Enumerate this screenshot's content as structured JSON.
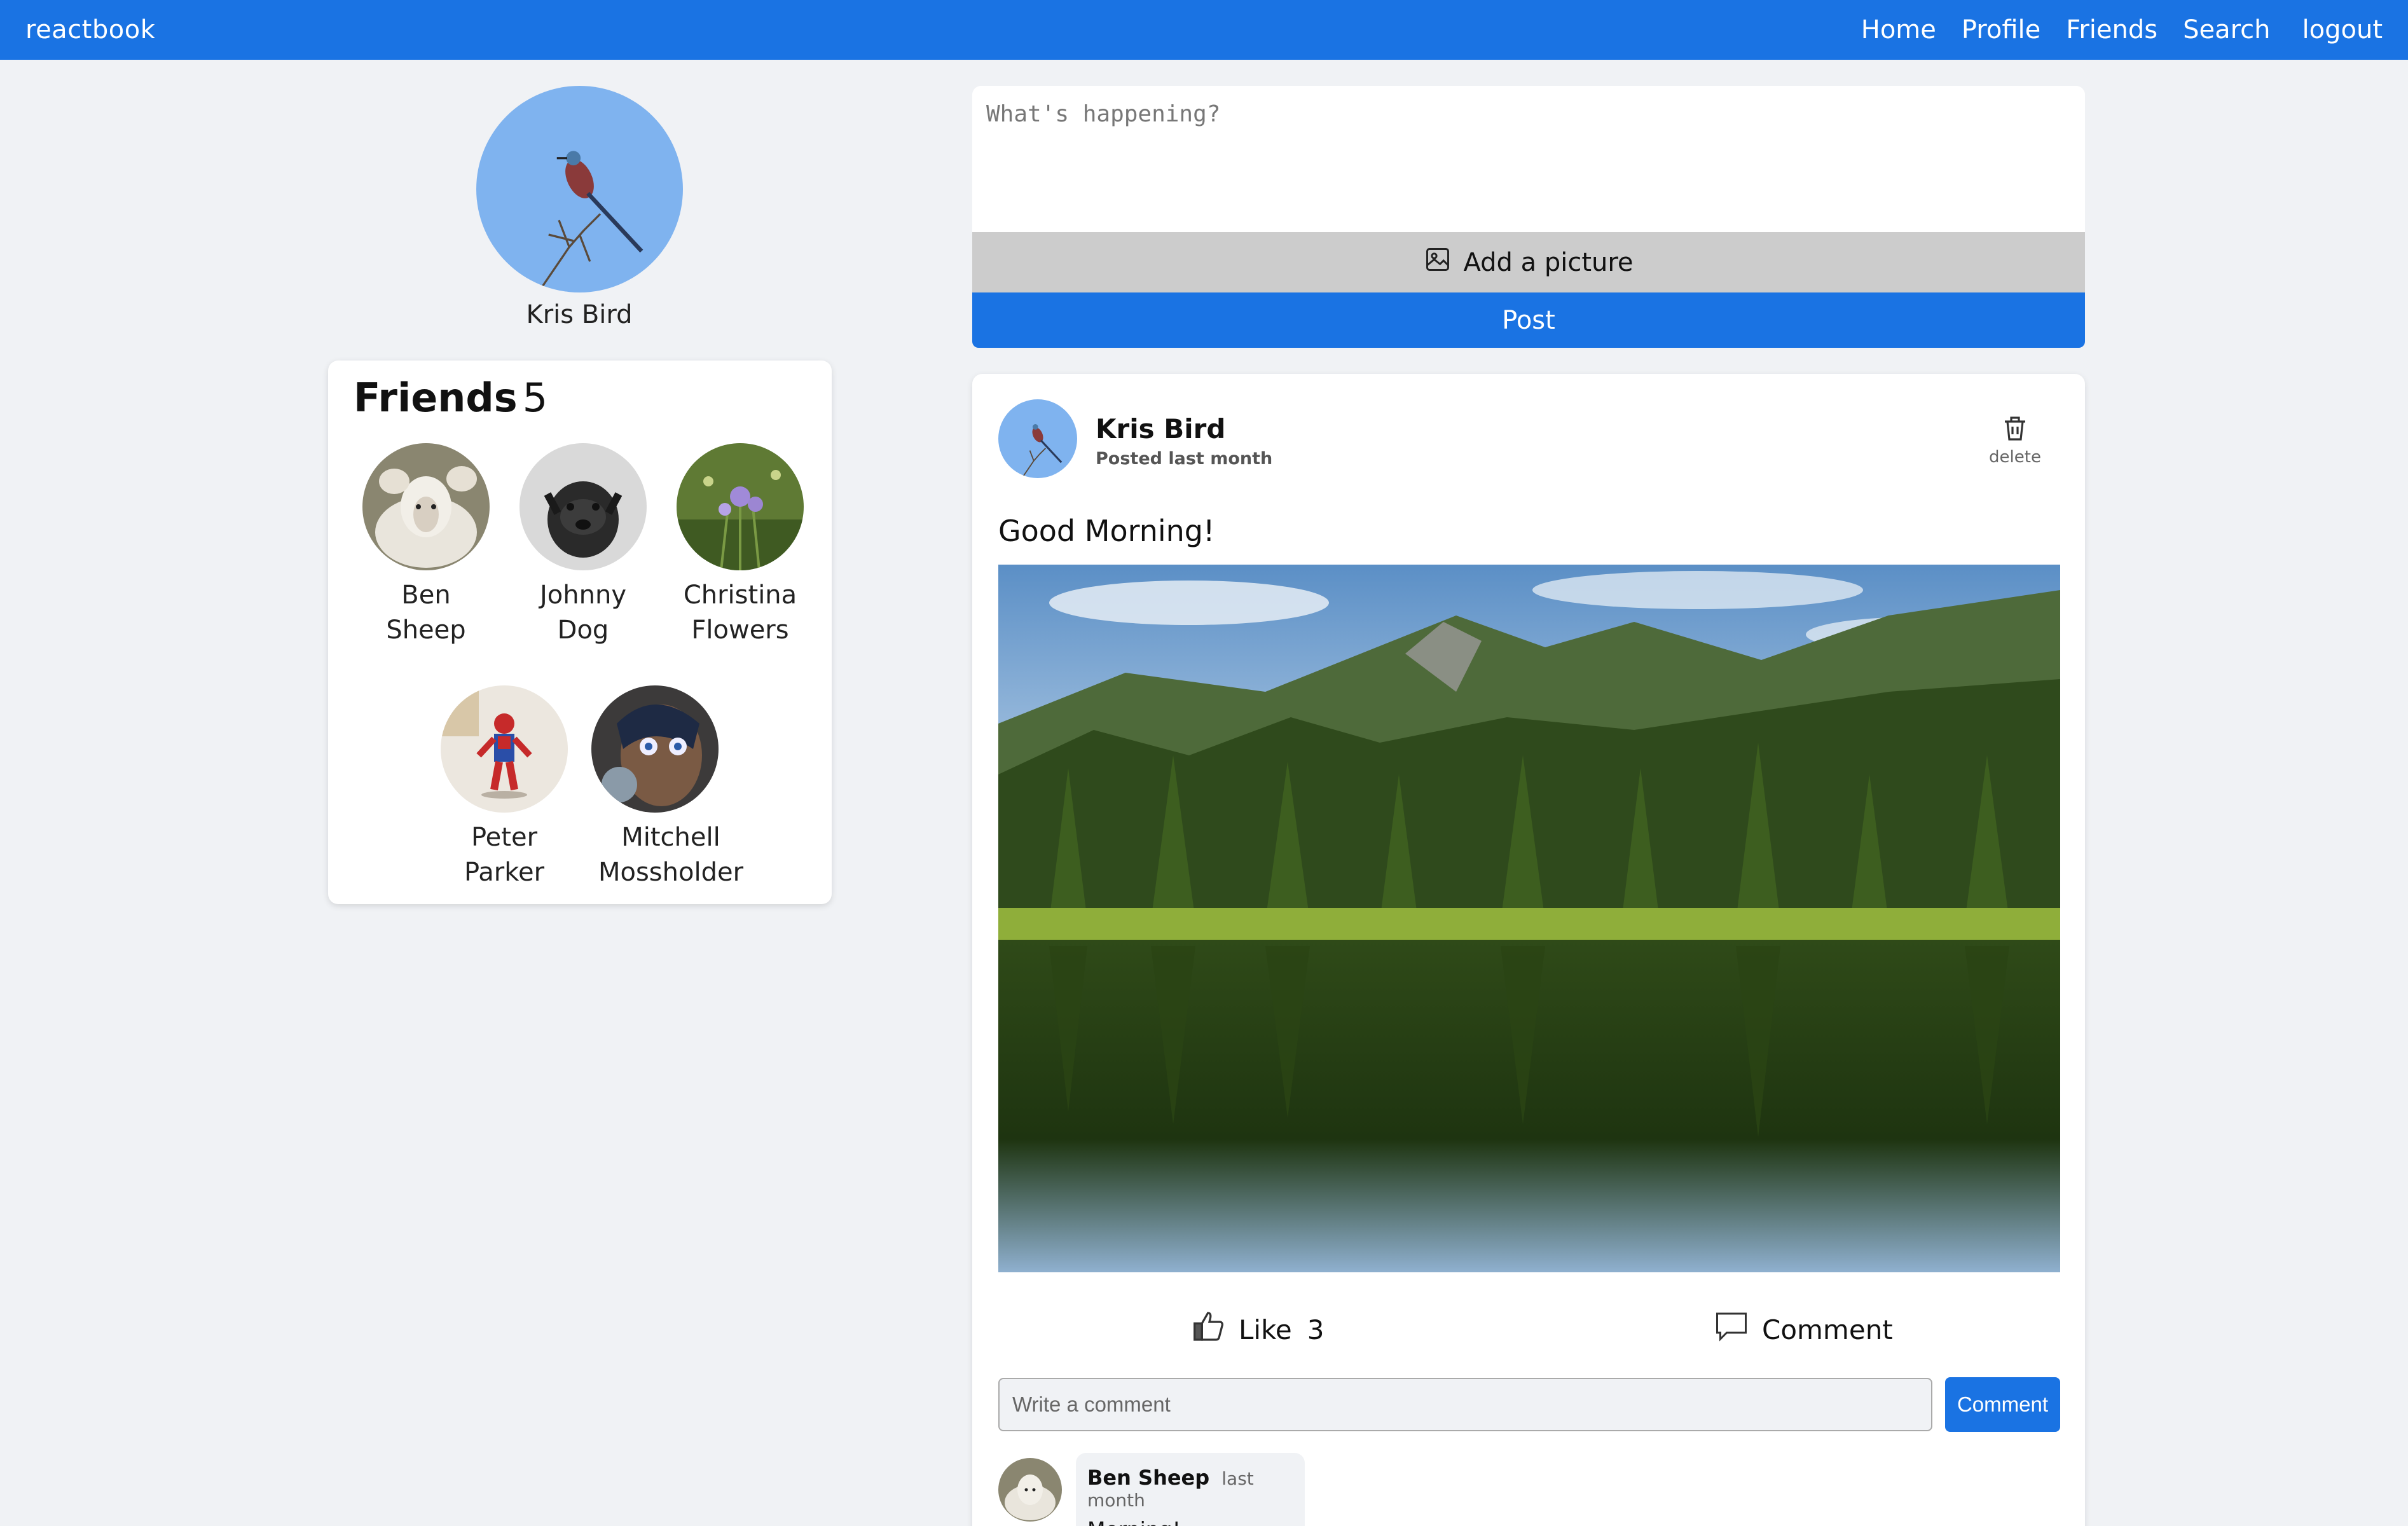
{
  "nav": {
    "brand": "reactbook",
    "links": [
      "Home",
      "Profile",
      "Friends",
      "Search"
    ],
    "logout": "logout"
  },
  "profile": {
    "name": "Kris Bird"
  },
  "friends": {
    "title": "Friends",
    "count": "5",
    "list": [
      {
        "first": "Ben",
        "last": "Sheep"
      },
      {
        "first": "Johnny",
        "last": "Dog"
      },
      {
        "first": "Christina",
        "last": "Flowers"
      },
      {
        "first": "Peter",
        "last": "Parker"
      },
      {
        "first": "Mitchell",
        "last": "Mossholder"
      }
    ]
  },
  "composer": {
    "placeholder": "What's happening?",
    "add_picture": "Add a picture",
    "post": "Post"
  },
  "post": {
    "author": "Kris Bird",
    "time": "Posted last month",
    "delete": "delete",
    "text": "Good Morning!",
    "like_label": "Like",
    "like_count": "3",
    "comment_label": "Comment",
    "comment_placeholder": "Write a comment",
    "comment_submit": "Comment",
    "comments": [
      {
        "author": "Ben Sheep",
        "time": "last month",
        "body": "Morning!"
      }
    ]
  },
  "colors": {
    "primary": "#1a73e3",
    "background": "#f0f2f5",
    "add_picture_bg": "#cccccc"
  }
}
